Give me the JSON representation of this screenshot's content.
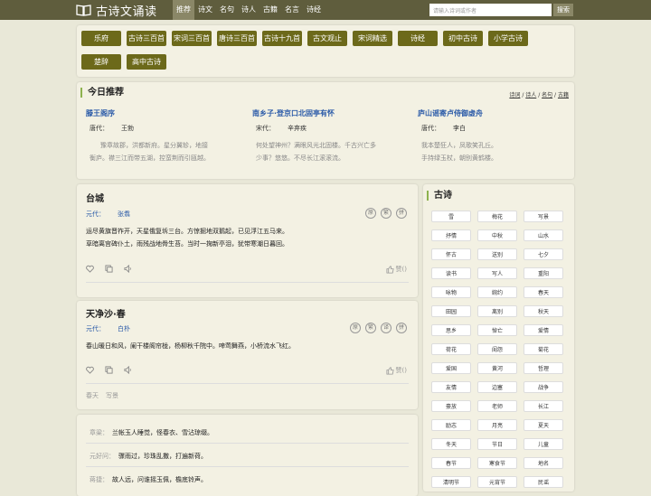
{
  "header": {
    "site_title": "古诗文诵读",
    "nav": [
      "推荐",
      "诗文",
      "名句",
      "诗人",
      "古籍",
      "名言",
      "诗经"
    ],
    "search_placeholder": "请输入诗词或作者",
    "search_button": "搜索"
  },
  "categories": [
    "乐府",
    "古诗三百首",
    "宋词三百首",
    "唐诗三百首",
    "古诗十九首",
    "古文观止",
    "宋词精选",
    "诗经",
    "初中古诗",
    "小学古诗",
    "楚辞",
    "高中古诗"
  ],
  "daily": {
    "title": "今日推荐",
    "links": [
      "诗词",
      "诗人",
      "名句",
      "古籍"
    ],
    "items": [
      {
        "title": "滕王阁序",
        "dynasty": "唐代：",
        "author": "王勃",
        "lines": [
          "豫章故郡，洪都新府。星分翼轸，地接",
          "衡庐。襟三江而带五湖，控蛮荆而引瓯越。"
        ]
      },
      {
        "title": "南乡子·登京口北固亭有怀",
        "dynasty": "宋代：",
        "author": "辛弃疾",
        "lines": [
          "何处望神州？满眼风光北固楼。千古兴亡多",
          "少事？悠悠。不尽长江滚滚流。"
        ]
      },
      {
        "title": "庐山谣寄卢侍御虚舟",
        "dynasty": "唐代：",
        "author": "李白",
        "lines": [
          "我本楚狂人，凤歌笑孔丘。",
          "手持绿玉杖，朝别黄鹤楼。"
        ]
      }
    ]
  },
  "poems": [
    {
      "title": "台城",
      "dynasty": "元代：",
      "author": "张翥",
      "badges": [
        "原",
        "繁",
        "拼"
      ],
      "lines": [
        "运尽黄旗晋祚开，天星俄复坼三台。方惊掘地双鹅起，已见浮江五马来。",
        "草暗离宫碑仆土，雨残战地骨生苔。当时一掬新亭泪，犹带寒潮日暮回。"
      ],
      "zan": "赞()"
    },
    {
      "title": "天净沙·春",
      "dynasty": "元代：",
      "author": "白朴",
      "badges": [
        "原",
        "繁",
        "译",
        "拼"
      ],
      "lines": [
        "春山暖日和风，阑干楼阁帘栊，杨柳秋千院中。啼莺舞燕，小桥流水飞红。"
      ],
      "zan": "赞()",
      "tags": [
        "春天",
        "写景"
      ]
    }
  ],
  "mingju": [
    {
      "source": "章粱：",
      "text": "兰帐玉人睡觉，怪春衣、雪沾琼缀。"
    },
    {
      "source": "元好问：",
      "text": "骤雨过，珍珠乱撒，打遍新荷。"
    },
    {
      "source": "蒋捷：",
      "text": "故人远，问谁摇玉佩，檐底铃声。"
    }
  ],
  "sidebar": {
    "title": "古诗",
    "tags": [
      "雪",
      "梅花",
      "写景",
      "抒情",
      "中秋",
      "山水",
      "怀古",
      "送别",
      "七夕",
      "读书",
      "写人",
      "重阳",
      "咏物",
      "婉约",
      "春天",
      "田园",
      "离别",
      "秋天",
      "思乡",
      "悼亡",
      "爱情",
      "荷花",
      "闺怨",
      "菊花",
      "爱国",
      "黄河",
      "哲理",
      "友情",
      "边塞",
      "战争",
      "豪放",
      "老师",
      "长江",
      "励志",
      "月亮",
      "夏天",
      "冬天",
      "节日",
      "儿童",
      "春节",
      "寒食节",
      "地名",
      "清明节",
      "元宵节",
      "民谣"
    ]
  }
}
